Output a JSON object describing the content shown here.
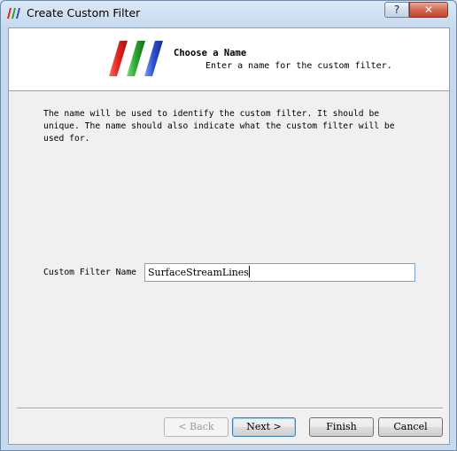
{
  "window": {
    "title": "Create Custom Filter",
    "help_label": "?",
    "close_label": "✕"
  },
  "header": {
    "title": "Choose a Name",
    "subtitle": "Enter a name for the custom filter."
  },
  "description": "The name will be used to identify the custom filter. It should be unique. The name should also indicate what the custom filter will be used for.",
  "form": {
    "label": "Custom Filter Name",
    "value": "SurfaceStreamLines"
  },
  "buttons": {
    "back": "< Back",
    "next": "Next >",
    "finish": "Finish",
    "cancel": "Cancel"
  },
  "colors": {
    "logo_red": "#e2241c",
    "logo_green": "#2aa52e",
    "logo_blue": "#2c4fd0"
  }
}
